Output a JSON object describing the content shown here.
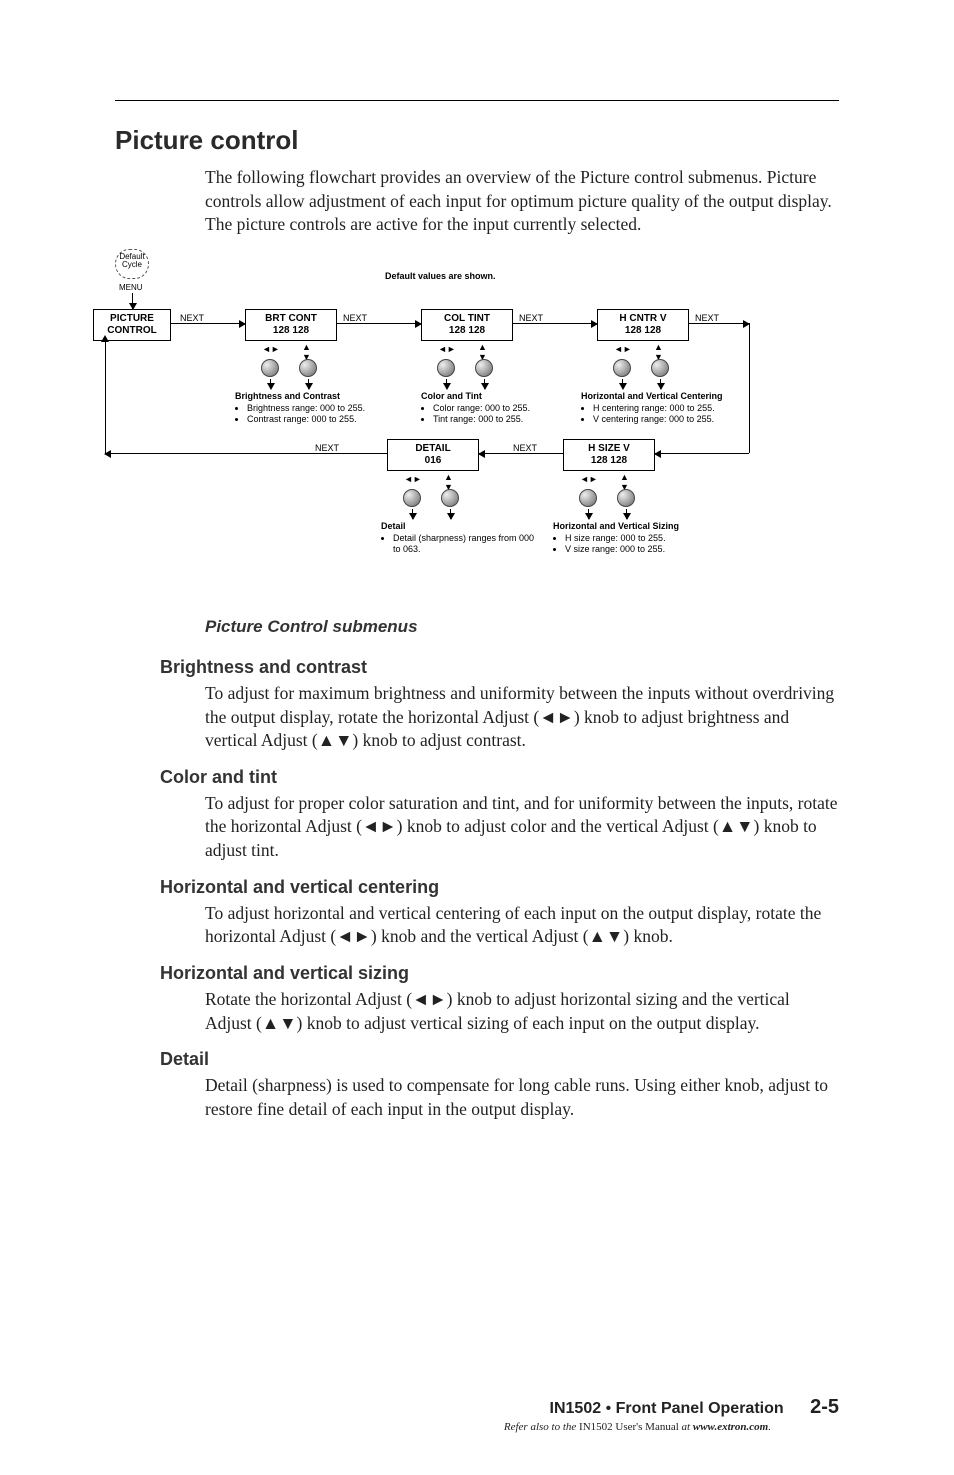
{
  "section_title": "Picture control",
  "intro": "The following flowchart provides an overview of the Picture control submenus.  Picture controls allow adjustment of each input for optimum picture quality of the output display.  The picture controls are active for the input currently selected.",
  "flow": {
    "menu_glyph_line1": "Default",
    "menu_glyph_line2": "Cycle",
    "menu_label": "MENU",
    "defaults_label": "Default values are shown.",
    "next": "NEXT",
    "picture_control": "PICTURE CONTROL",
    "brt_cont": {
      "l1": "BRT   CONT",
      "l2": "128     128"
    },
    "col_tint": {
      "l1": "COL   TINT",
      "l2": "128     128"
    },
    "hcntr": {
      "l1": "H  CNTR  V",
      "l2": "128     128"
    },
    "hsize": {
      "l1": "H  SIZE  V",
      "l2": "128     128"
    },
    "detail": {
      "l1": "DETAIL",
      "l2": "016"
    },
    "desc": {
      "brt": {
        "title": "Brightness and Contrast",
        "b1": "Brightness range: 000 to 255.",
        "b2": "Contrast range:  000 to 255."
      },
      "col": {
        "title": "Color and Tint",
        "b1": "Color range: 000 to 255.",
        "b2": "Tint range: 000 to 255."
      },
      "ctr": {
        "title": "Horizontal and Vertical Centering",
        "b1": "H centering range:  000 to 255.",
        "b2": "V centering range:  000 to 255."
      },
      "siz": {
        "title": "Horizontal and Vertical Sizing",
        "b1": "H size range:  000 to 255.",
        "b2": "V size range:  000 to 255."
      },
      "det": {
        "title": "Detail",
        "b1": "Detail (sharpness) ranges from 000 to 063."
      }
    }
  },
  "subcaption": "Picture Control submenus",
  "subs": {
    "brightness": {
      "h": "Brightness and contrast",
      "p": "To adjust for maximum brightness and uniformity between the inputs without overdriving the output display, rotate the horizontal Adjust (◄►) knob to adjust brightness and vertical Adjust (▲▼) knob to adjust contrast."
    },
    "color": {
      "h": "Color and tint",
      "p": "To adjust for proper color saturation and tint, and for uniformity between the inputs, rotate the horizontal Adjust (◄►) knob to adjust color and the vertical Adjust (▲▼) knob to adjust tint."
    },
    "center": {
      "h": "Horizontal and vertical centering",
      "p": "To adjust horizontal and vertical centering of each input on the output display, rotate the horizontal Adjust (◄►) knob and the vertical Adjust (▲▼) knob."
    },
    "sizing": {
      "h": "Horizontal and vertical sizing",
      "p": "Rotate the horizontal Adjust (◄►) knob to adjust horizontal sizing and the vertical Adjust (▲▼) knob to adjust vertical sizing of each input on the output display."
    },
    "detail": {
      "h": "Detail",
      "p": "Detail (sharpness) is used to compensate for long cable runs.  Using either knob, adjust to restore fine detail of each input in the output display."
    }
  },
  "footer": {
    "product": "IN1502",
    "chapter": "Front Panel Operation",
    "page": "2-5",
    "refer_prefix": "Refer also to the ",
    "refer_manual": "IN1502 User's Manual",
    "refer_at": " at ",
    "refer_url": "www.extron.com",
    "refer_suffix": "."
  }
}
